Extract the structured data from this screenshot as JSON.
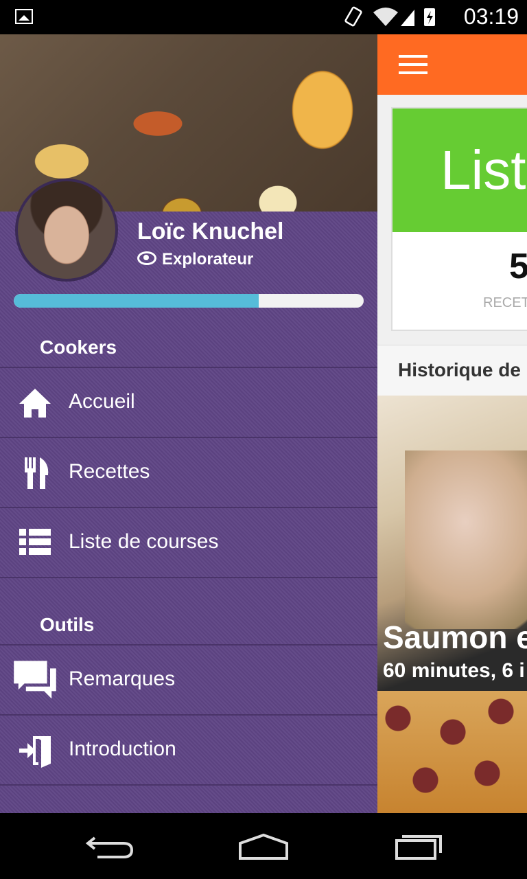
{
  "status_bar": {
    "time": "03:19"
  },
  "drawer": {
    "user": {
      "name": "Loïc Knuchel",
      "rank": "Explorateur",
      "progress_pct": 70
    },
    "sections": [
      {
        "title": "Cookers",
        "items": [
          {
            "label": "Accueil"
          },
          {
            "label": "Recettes"
          },
          {
            "label": "Liste de courses"
          }
        ]
      },
      {
        "title": "Outils",
        "items": [
          {
            "label": "Remarques"
          },
          {
            "label": "Introduction"
          }
        ]
      }
    ]
  },
  "background_app": {
    "card_title": "Liste",
    "card_number": "5",
    "card_label": "RECETTES",
    "history_header": "Historique de",
    "recipe": {
      "title": "Saumon e",
      "meta": "60 minutes, 6 i"
    }
  },
  "colors": {
    "drawer": "#5f4585",
    "appbar": "#ff6a22",
    "card_green": "#66cc33",
    "progress": "#56bcd9"
  }
}
